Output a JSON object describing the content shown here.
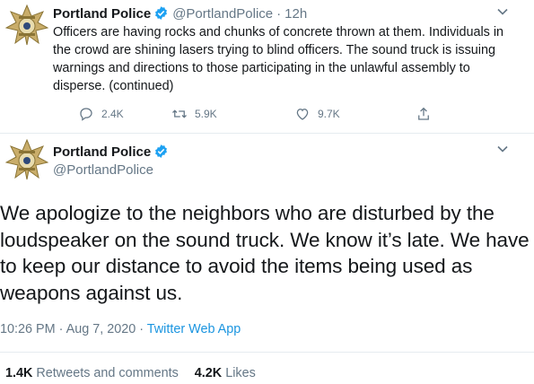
{
  "tweet1": {
    "author_name": "Portland Police",
    "handle": "@PortlandPolice",
    "separator": "·",
    "time": "12h",
    "text": "Officers are having rocks and chunks of concrete thrown at them. Individuals in the crowd are shining lasers trying to blind officers. The sound truck is issuing warnings and directions to those participating in the unlawful assembly to disperse. (continued)",
    "reply_count": "2.4K",
    "retweet_count": "5.9K",
    "like_count": "9.7K",
    "icons": [
      "badge-icon",
      "verified-icon",
      "chevron-down-icon",
      "reply-icon",
      "retweet-icon",
      "like-icon",
      "share-icon"
    ]
  },
  "tweet2": {
    "author_name": "Portland Police",
    "handle": "@PortlandPolice",
    "text": "We apologize to the neighbors who are disturbed by the loudspeaker on the sound truck. We know it’s late. We have to keep our distance to avoid the items being used as weapons against us.",
    "timestamp": "10:26 PM · Aug 7, 2020",
    "separator": "·",
    "app": "Twitter Web App",
    "retweets_value": "1.4K",
    "retweets_label": "Retweets and comments",
    "likes_value": "4.2K",
    "likes_label": "Likes"
  },
  "colors": {
    "text": "#14171a",
    "secondary": "#657786",
    "link": "#1b95e0",
    "verified": "#1da1f2",
    "divider": "#e6ecf0"
  }
}
